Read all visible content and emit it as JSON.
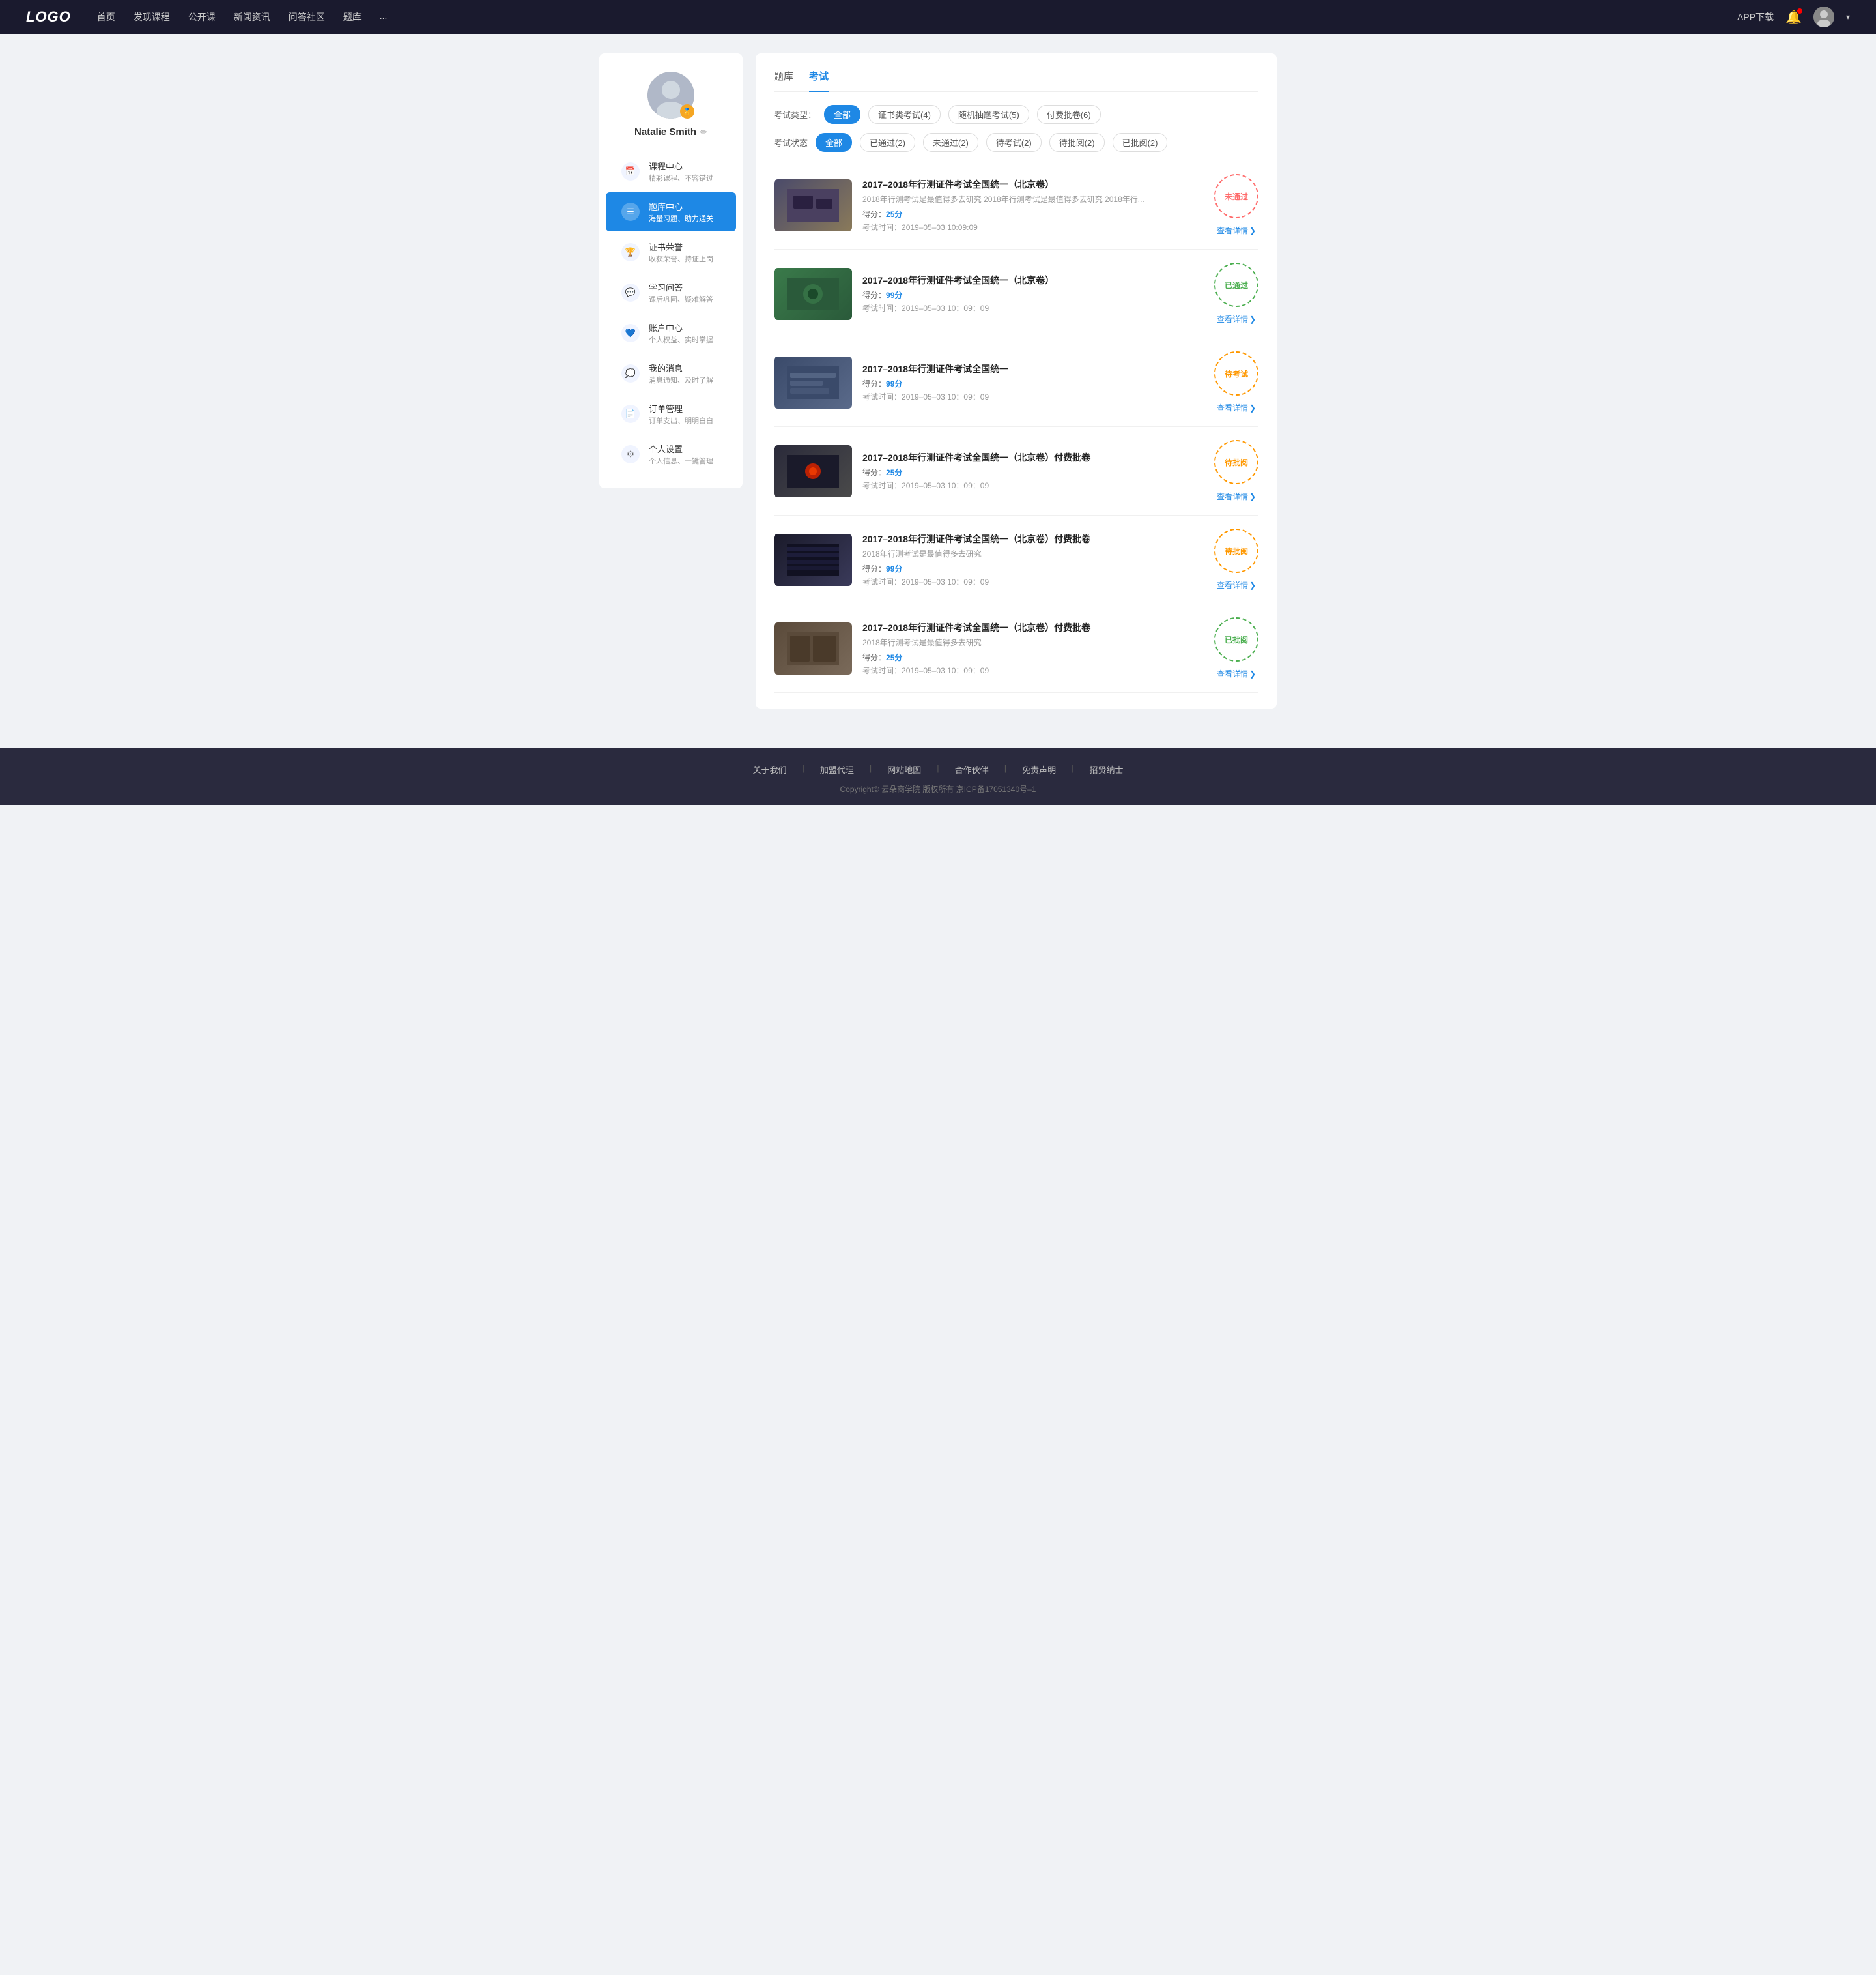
{
  "nav": {
    "logo": "LOGO",
    "links": [
      "首页",
      "发现课程",
      "公开课",
      "新闻资讯",
      "问答社区",
      "题库",
      "..."
    ],
    "app_download": "APP下载",
    "dropdown_arrow": "▾"
  },
  "sidebar": {
    "profile": {
      "name": "Natalie Smith",
      "edit_icon": "✏",
      "badge": "🏅"
    },
    "menu_items": [
      {
        "id": "course",
        "icon": "📅",
        "title": "课程中心",
        "sub": "精彩课程、不容错过",
        "active": false
      },
      {
        "id": "question",
        "icon": "☰",
        "title": "题库中心",
        "sub": "海量习题、助力通关",
        "active": true
      },
      {
        "id": "badge",
        "icon": "🏆",
        "title": "证书荣誉",
        "sub": "收获荣誉、持证上岗",
        "active": false
      },
      {
        "id": "qa",
        "icon": "💬",
        "title": "学习问答",
        "sub": "课后巩固、疑难解答",
        "active": false
      },
      {
        "id": "account",
        "icon": "💙",
        "title": "账户中心",
        "sub": "个人权益、实时掌握",
        "active": false
      },
      {
        "id": "message",
        "icon": "💭",
        "title": "我的消息",
        "sub": "消息通知、及时了解",
        "active": false
      },
      {
        "id": "order",
        "icon": "📄",
        "title": "订单管理",
        "sub": "订单支出、明明白白",
        "active": false
      },
      {
        "id": "setting",
        "icon": "⚙",
        "title": "个人设置",
        "sub": "个人信息、一键管理",
        "active": false
      }
    ]
  },
  "main": {
    "tabs": [
      {
        "id": "question-bank",
        "label": "题库",
        "active": false
      },
      {
        "id": "exam",
        "label": "考试",
        "active": true
      }
    ],
    "filter_type_label": "考试类型：",
    "filter_types": [
      {
        "label": "全部",
        "active": true
      },
      {
        "label": "证书类考试(4)",
        "active": false
      },
      {
        "label": "随机抽题考试(5)",
        "active": false
      },
      {
        "label": "付费批卷(6)",
        "active": false
      }
    ],
    "filter_status_label": "考试状态",
    "filter_statuses": [
      {
        "label": "全部",
        "active": true
      },
      {
        "label": "已通过(2)",
        "active": false
      },
      {
        "label": "未通过(2)",
        "active": false
      },
      {
        "label": "待考试(2)",
        "active": false
      },
      {
        "label": "待批阅(2)",
        "active": false
      },
      {
        "label": "已批阅(2)",
        "active": false
      }
    ],
    "exams": [
      {
        "id": 1,
        "title": "2017–2018年行测证件考试全国统一（北京卷）",
        "desc": "2018年行测考试是最值得多去研究 2018年行测考试是最值得多去研究 2018年行...",
        "score_label": "得分：",
        "score": "25分",
        "time_label": "考试时间：",
        "time": "2019–05–03  10:09:09",
        "status": "未通过",
        "stamp_class": "stamp-notpassed",
        "detail_label": "查看详情",
        "thumb_class": "thumb-1"
      },
      {
        "id": 2,
        "title": "2017–2018年行测证件考试全国统一（北京卷）",
        "desc": "",
        "score_label": "得分：",
        "score": "99分",
        "time_label": "考试时间：",
        "time": "2019–05–03  10：09：09",
        "status": "已通过",
        "stamp_class": "stamp-passed",
        "detail_label": "查看详情",
        "thumb_class": "thumb-2"
      },
      {
        "id": 3,
        "title": "2017–2018年行测证件考试全国统一",
        "desc": "",
        "score_label": "得分：",
        "score": "99分",
        "time_label": "考试时间：",
        "time": "2019–05–03  10：09：09",
        "status": "待考试",
        "stamp_class": "stamp-pending",
        "detail_label": "查看详情",
        "thumb_class": "thumb-3"
      },
      {
        "id": 4,
        "title": "2017–2018年行测证件考试全国统一（北京卷）付费批卷",
        "desc": "",
        "score_label": "得分：",
        "score": "25分",
        "time_label": "考试时间：",
        "time": "2019–05–03  10：09：09",
        "status": "待批阅",
        "stamp_class": "stamp-review",
        "detail_label": "查看详情",
        "thumb_class": "thumb-4"
      },
      {
        "id": 5,
        "title": "2017–2018年行测证件考试全国统一（北京卷）付费批卷",
        "desc": "2018年行测考试是最值得多去研究",
        "score_label": "得分：",
        "score": "99分",
        "time_label": "考试时间：",
        "time": "2019–05–03  10：09：09",
        "status": "待批阅",
        "stamp_class": "stamp-review",
        "detail_label": "查看详情",
        "thumb_class": "thumb-5"
      },
      {
        "id": 6,
        "title": "2017–2018年行测证件考试全国统一（北京卷）付费批卷",
        "desc": "2018年行测考试是最值得多去研究",
        "score_label": "得分：",
        "score": "25分",
        "time_label": "考试时间：",
        "time": "2019–05–03  10：09：09",
        "status": "已批阅",
        "stamp_class": "stamp-reviewed",
        "detail_label": "查看详情",
        "thumb_class": "thumb-6"
      }
    ]
  },
  "footer": {
    "links": [
      "关于我们",
      "加盟代理",
      "网站地图",
      "合作伙伴",
      "免责声明",
      "招贤纳士"
    ],
    "copyright": "Copyright© 云朵商学院  版权所有    京ICP备17051340号–1"
  }
}
